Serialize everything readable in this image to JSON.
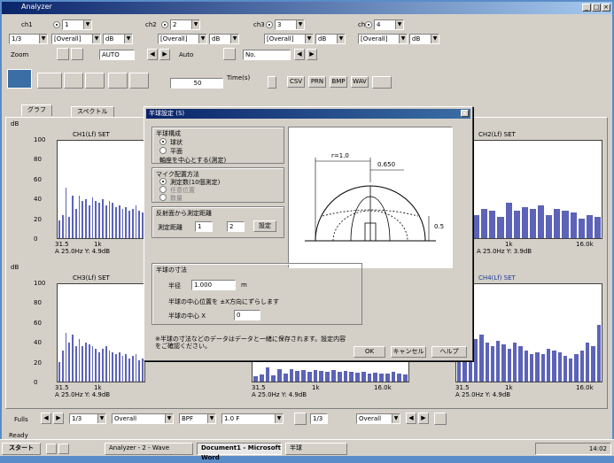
{
  "window": {
    "title": "Analyzer",
    "close_glyph": "×",
    "max_glyph": "□",
    "min_glyph": "_"
  },
  "toolbar": {
    "channels": [
      {
        "label": "ch1",
        "value": "1"
      },
      {
        "label": "ch2",
        "value": "2"
      },
      {
        "label": "ch3",
        "value": "3"
      },
      {
        "label": "ch4",
        "value": "4"
      }
    ],
    "row2": [
      {
        "value": "1/3"
      },
      {
        "value": "[Overall]"
      },
      {
        "value": "dB"
      },
      {
        "value": "[Overall]"
      },
      {
        "value": "dB"
      },
      {
        "value": "[Overall]"
      },
      {
        "value": "dB"
      },
      {
        "value": "[Overall]"
      },
      {
        "value": "dB"
      }
    ],
    "row3": {
      "left_label": "Zoom",
      "mid_value": "AUTO",
      "right_label": "Auto",
      "right_value": "No."
    },
    "row4": {
      "center_value": "50",
      "label": "Time(s)",
      "btns": [
        "CSV",
        "PRN",
        "BMP",
        "WAV"
      ]
    }
  },
  "tabs": [
    {
      "label": "グラフ"
    },
    {
      "label": "スペクトル"
    }
  ],
  "plots": [
    {
      "id": "p1",
      "unit": "dB",
      "title": "CH1(Lf) SET",
      "bars": [
        18,
        24,
        52,
        22,
        44,
        30,
        44,
        38,
        40,
        34,
        42,
        38,
        36,
        40,
        34,
        38,
        36,
        32,
        34,
        30,
        32,
        28,
        30,
        34,
        28,
        26
      ],
      "xticks": [
        "31.5",
        "1k",
        "16.0k"
      ],
      "info": "A  25.0Hz  Y:  4.9dB"
    },
    {
      "id": "p2",
      "unit": "",
      "title": "CH2(Lf) SET",
      "bars": [
        24,
        30,
        28,
        22,
        36,
        28,
        32,
        30,
        34,
        24,
        30,
        28,
        26,
        20,
        24,
        22
      ],
      "xticks": [
        "",
        "1k",
        "16.0k"
      ],
      "info": "A  25.0Hz  Y:  3.9dB"
    },
    {
      "id": "p3",
      "unit": "dB",
      "title": "CH3(Lf) SET",
      "bars": [
        20,
        32,
        50,
        40,
        48,
        36,
        44,
        36,
        40,
        38,
        36,
        34,
        30,
        34,
        36,
        32,
        30,
        28,
        30,
        26,
        28,
        24,
        26,
        28,
        22,
        24
      ],
      "xticks": [
        "31.5",
        "1k",
        "16.0k"
      ],
      "info": "A  25.0Hz  Y:  4.9dB"
    },
    {
      "id": "p4",
      "unit": "",
      "title": "CH4(Lf) SET",
      "bars": [
        30,
        40,
        52,
        44,
        48,
        40,
        36,
        42,
        38,
        34,
        40,
        36,
        32,
        28,
        30,
        28,
        34,
        32,
        30,
        26,
        24,
        28,
        32,
        40,
        36,
        58
      ],
      "xticks": [
        "31.5",
        "1k",
        "16.0k"
      ],
      "info": "A  25.0Hz  Y:  4.9dB"
    }
  ],
  "yticks": [
    "100",
    "80",
    "60",
    "40",
    "20",
    "0"
  ],
  "dialog": {
    "title": "半球設定 (S)",
    "g1_title": "半球構成",
    "g1_options": [
      "球状",
      "平面",
      "軸座を中心とする(測定)"
    ],
    "g2_title": "マイク配置方法",
    "g2_options": [
      "測定数(10個測定)",
      "任意位置",
      "数量"
    ],
    "g3_title": "反射面から測定距離",
    "g3_label": "測定距離",
    "g3_v1": "1",
    "g3_v2": "2",
    "g3_btn": "設定",
    "g4_title": "半球の寸法",
    "g4_label1": "半径",
    "g4_v1": "1.000",
    "g4_unit": "m",
    "g4_note": "半球の中心位置を ±X方向にずらします",
    "g4_label2": "半球の中心 X",
    "g4_v2": "0",
    "footnote": "※半球の寸法などのデータはデータと一緒に保存されます。設定内容をご確認ください。",
    "diagram_labels": {
      "top": "r=1.0",
      "mid": "0.650",
      "right": "0.5",
      "left": ""
    },
    "buttons": [
      "OK",
      "キャンセル",
      "ヘルプ"
    ]
  },
  "bottom_ctrl": {
    "label": "Fulls",
    "values": [
      "1/3",
      "Overall",
      "BPF",
      "1.0 F",
      "1/3"
    ],
    "btn": "Overall"
  },
  "status_text": "Ready",
  "taskbar": {
    "start": "スタート",
    "items": [
      "Analyzer - 2 - Wave",
      "Document1 - Microsoft Word",
      "半球"
    ],
    "clock": "14:02"
  }
}
